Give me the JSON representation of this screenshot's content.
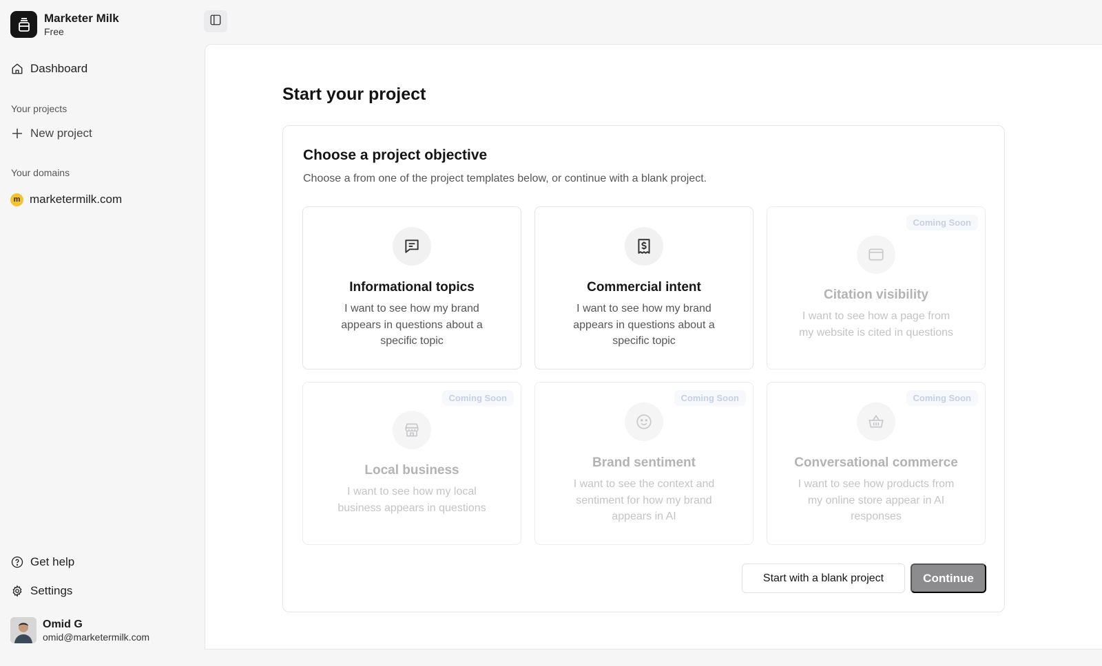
{
  "sidebar": {
    "brand_name": "Marketer Milk",
    "plan": "Free",
    "dashboard_label": "Dashboard",
    "projects_section": "Your projects",
    "new_project_label": "New project",
    "domains_section": "Your domains",
    "domain_initial": "m",
    "domain": "marketermilk.com",
    "help_label": "Get help",
    "settings_label": "Settings",
    "user_name": "Omid G",
    "user_email": "omid@marketermilk.com"
  },
  "main": {
    "title": "Start your project",
    "card": {
      "title": "Choose a project objective",
      "description": "Choose a from one of the project templates below, or continue with a blank project.",
      "tiles": [
        {
          "title": "Informational topics",
          "description": "I want to see how my brand appears in questions about a specific topic",
          "icon": "message-lines-icon",
          "enabled": true,
          "badge": ""
        },
        {
          "title": "Commercial intent",
          "description": "I want to see how my brand appears in questions about a specific topic",
          "icon": "receipt-dollar-icon",
          "enabled": true,
          "badge": ""
        },
        {
          "title": "Citation visibility",
          "description": "I want to see how a page from my website is cited in questions",
          "icon": "browser-window-icon",
          "enabled": false,
          "badge": "Coming Soon"
        },
        {
          "title": "Local business",
          "description": "I want to see how my local business appears in questions",
          "icon": "storefront-icon",
          "enabled": false,
          "badge": "Coming Soon"
        },
        {
          "title": "Brand sentiment",
          "description": "I want to see the context and sentiment for how my brand appears in AI",
          "icon": "smile-icon",
          "enabled": false,
          "badge": "Coming Soon"
        },
        {
          "title": "Conversational commerce",
          "description": "I want to see how products from my online store appear in AI responses",
          "icon": "basket-icon",
          "enabled": false,
          "badge": "Coming Soon"
        }
      ]
    },
    "blank_button": "Start with a blank project",
    "continue_button": "Continue"
  },
  "colors": {
    "sidebar_bg": "#f6f6f7",
    "primary_disabled": "#8c8c8e",
    "badge_text": "#c5d0e0",
    "domain_dot": "#f4c330"
  }
}
